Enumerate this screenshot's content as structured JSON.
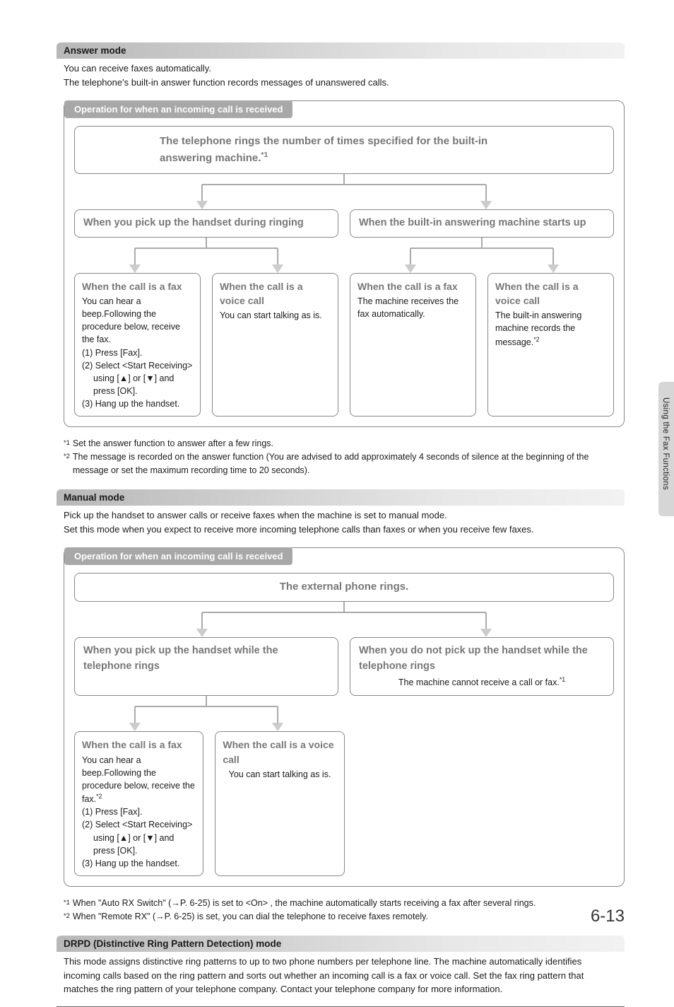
{
  "sidebar": {
    "label": "Using the Fax Functions"
  },
  "page_number": "6-13",
  "section1": {
    "title": "Answer mode",
    "intro1": "You can receive faxes automatically.",
    "intro2": "The telephone's built-in answer function records messages of unanswered calls.",
    "op_label": "Operation for when an incoming call is received",
    "top_box": "The telephone rings the number of times specified for the built-in answering machine.",
    "top_box_sup": "*1",
    "left_branch": "When you pick up the handset during ringing",
    "right_branch": "When the built-in answering machine starts up",
    "leaf1_title": "When the call is a fax",
    "leaf1_l1": "You can hear a beep.Following the procedure below, receive the fax.",
    "leaf1_s1": "(1) Press [Fax].",
    "leaf1_s2": "(2) Select <Start Receiving> using [▲] or [▼] and press [OK].",
    "leaf1_s3": "(3) Hang up the handset.",
    "leaf2_title": "When the call is a voice call",
    "leaf2_body": "You can start talking as is.",
    "leaf3_title": "When the call is a fax",
    "leaf3_body": "The machine receives the fax automatically.",
    "leaf4_title": "When the call is a voice call",
    "leaf4_body": "The built-in answering machine records the message.",
    "leaf4_sup": "*2",
    "fn1_marker": "*1",
    "fn1": "Set the answer function to answer after a few rings.",
    "fn2_marker": "*2",
    "fn2": "The message is recorded on the answer function (You are advised to add approximately 4 seconds of silence at the beginning of the message or set the maximum recording time to 20 seconds)."
  },
  "section2": {
    "title": "Manual mode",
    "intro1": "Pick up the handset to answer calls or receive faxes when the machine is set to manual mode.",
    "intro2": "Set this mode when you expect to receive more incoming telephone calls than faxes or when you receive few faxes.",
    "op_label": "Operation for when an incoming call is received",
    "top_box": "The external phone rings.",
    "left_branch": "When you pick up the handset while the telephone rings",
    "right_branch": "When you do not pick up the handset while the telephone rings",
    "right_sub": "The machine cannot receive a call or fax.",
    "right_sub_sup": "*1",
    "leaf1_title": "When the call is a fax",
    "leaf1_l1": "You can hear a beep.Following the procedure below, receive the fax.",
    "leaf1_sup": "*2",
    "leaf1_s1": "(1) Press [Fax].",
    "leaf1_s2": "(2) Select <Start Receiving> using [▲] or [▼] and press [OK].",
    "leaf1_s3": "(3) Hang up the handset.",
    "leaf2_title": "When the call is a voice call",
    "leaf2_body": "You can start talking as is.",
    "fn1_marker": "*1",
    "fn1a": "When \"Auto RX Switch\" (",
    "fn1b": "P. 6-25) is set to <On> , the machine automatically starts receiving a fax after several rings.",
    "fn2_marker": "*2",
    "fn2a": "When \"Remote RX\" (",
    "fn2b": "P. 6-25) is set, you can dial the telephone to receive faxes remotely."
  },
  "section3": {
    "title": "DRPD (Distinctive Ring Pattern Detection) mode",
    "body": "This mode assigns distinctive ring patterns to up to two phone numbers per telephone line. The machine automatically identifies incoming calls based on the ring pattern and sorts out whether an incoming call is a fax or voice call. Set the fax ring pattern that matches the ring pattern of your telephone company. Contact your telephone company for more information."
  }
}
